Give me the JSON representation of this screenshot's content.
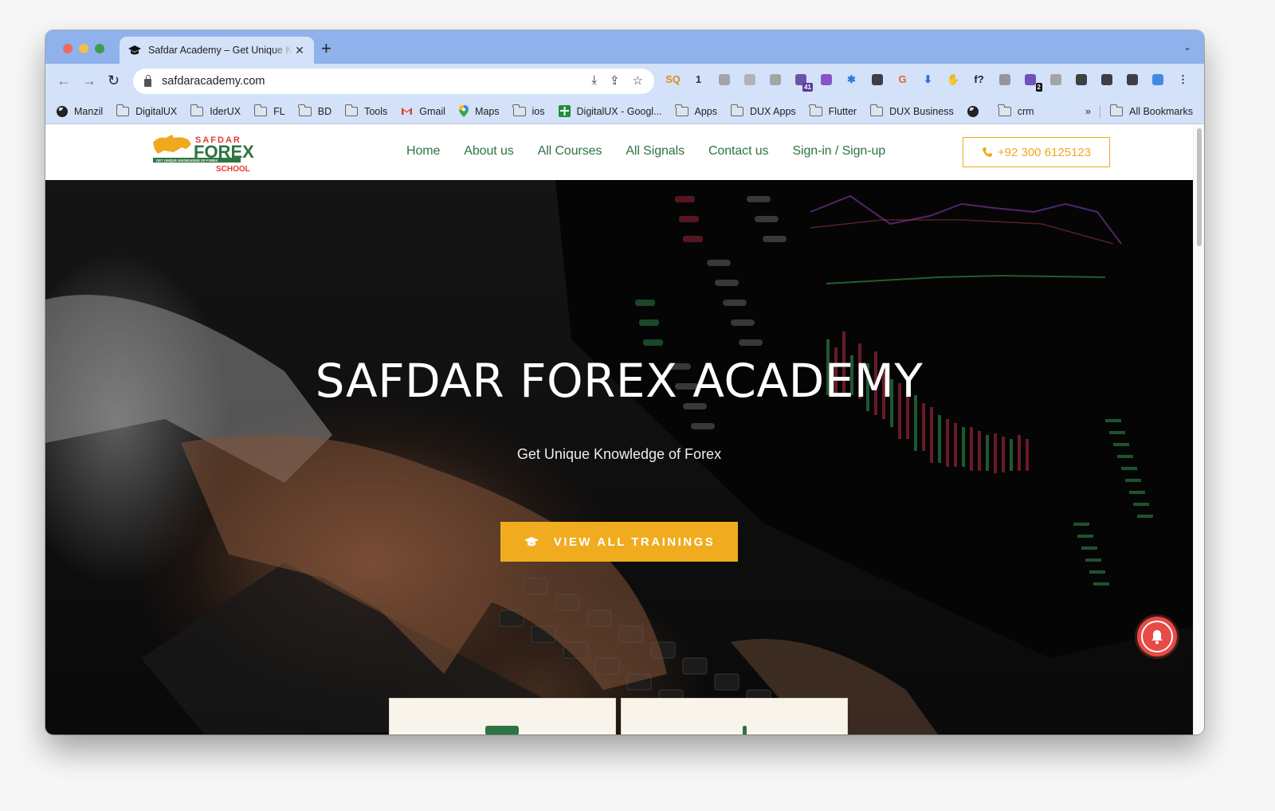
{
  "browser": {
    "tab": {
      "title": "Safdar Academy – Get Unique Knowledge of Forex",
      "favicon": "graduation-cap-icon"
    },
    "url": "safdaracademy.com",
    "extensions": [
      {
        "name": "sq-extension",
        "label": "SQ",
        "color": "#e08a1e"
      },
      {
        "name": "counter-extension",
        "label": "1",
        "color": "#333333"
      },
      {
        "name": "globe-extension",
        "label": "",
        "color": "#999999"
      },
      {
        "name": "script-extension",
        "label": "",
        "color": "#aaaaaa"
      },
      {
        "name": "camera-extension",
        "label": "",
        "color": "#999999"
      },
      {
        "name": "cap-extension",
        "label": "",
        "color": "#5a3a9a",
        "badge": "41"
      },
      {
        "name": "chat-extension",
        "label": "",
        "color": "#7a3ac0"
      },
      {
        "name": "snowflake-extension",
        "label": "✱",
        "color": "#2a7ae0"
      },
      {
        "name": "drop-extension",
        "label": "",
        "color": "#222222"
      },
      {
        "name": "grammarly-g-extension",
        "label": "G",
        "color": "#e8612c"
      },
      {
        "name": "download-arrow-extension",
        "label": "⬇",
        "color": "#2a6ed8"
      },
      {
        "name": "stop-hand-extension",
        "label": "✋",
        "color": "#e8322c"
      },
      {
        "name": "font-finder-extension",
        "label": "f?",
        "color": "#222222"
      },
      {
        "name": "video-extension",
        "label": "",
        "color": "#888888"
      },
      {
        "name": "link-extension",
        "label": "",
        "color": "#5a3ab0",
        "badge": "2"
      },
      {
        "name": "cast-extension",
        "label": "",
        "color": "#999999"
      },
      {
        "name": "puzzle-extensions",
        "label": "",
        "color": "#222222"
      },
      {
        "name": "downloads",
        "label": "",
        "color": "#222222"
      },
      {
        "name": "side-panel",
        "label": "",
        "color": "#222222"
      },
      {
        "name": "profile-avatar",
        "label": "",
        "color": "#2a7ae0"
      },
      {
        "name": "menu-kebab",
        "label": "⋮",
        "color": "#222222"
      }
    ],
    "bookmarks": [
      {
        "label": "Manzil",
        "icon": "globe-icon"
      },
      {
        "label": "DigitalUX",
        "icon": "folder-icon"
      },
      {
        "label": "IderUX",
        "icon": "folder-icon"
      },
      {
        "label": "FL",
        "icon": "folder-icon"
      },
      {
        "label": "BD",
        "icon": "folder-icon"
      },
      {
        "label": "Tools",
        "icon": "folder-icon"
      },
      {
        "label": "Gmail",
        "icon": "gmail-icon"
      },
      {
        "label": "Maps",
        "icon": "maps-icon"
      },
      {
        "label": "ios",
        "icon": "folder-icon"
      },
      {
        "label": "DigitalUX - Googl...",
        "icon": "sheets-icon"
      },
      {
        "label": "Apps",
        "icon": "folder-icon"
      },
      {
        "label": "DUX Apps",
        "icon": "folder-icon"
      },
      {
        "label": "Flutter",
        "icon": "folder-icon"
      },
      {
        "label": "DUX Business",
        "icon": "folder-icon"
      },
      {
        "label": "",
        "icon": "globe-icon"
      },
      {
        "label": "crm",
        "icon": "folder-icon"
      }
    ],
    "bookmarks_overflow": "»",
    "all_bookmarks": "All Bookmarks"
  },
  "site": {
    "logo": {
      "top": "SAFDAR",
      "main": "FOREX",
      "tagline": "GET UNIQUE KNOWLEDGE OF FOREX",
      "bottom": "SCHOOL"
    },
    "nav": [
      "Home",
      "About us",
      "All Courses",
      "All Signals",
      "Contact us",
      "Sign-in / Sign-up"
    ],
    "phone": "+92 300 6125123",
    "colors": {
      "nav_green": "#2e7443",
      "accent_orange": "#f0ac1e",
      "bell_red": "#e84a45",
      "card_bg": "#f8f4ec"
    }
  },
  "hero": {
    "title": "SAFDAR FOREX ACADEMY",
    "subtitle": "Get Unique Knowledge of Forex",
    "cta": "VIEW ALL TRAININGS"
  }
}
